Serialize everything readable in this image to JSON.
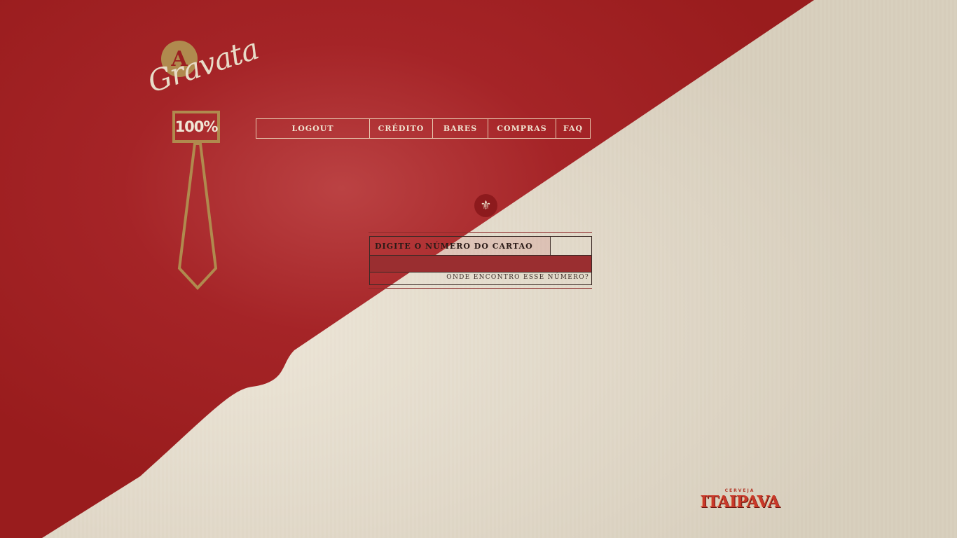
{
  "logo": {
    "letter": "A",
    "word": "Gravata",
    "badge": "100%"
  },
  "nav": {
    "items": [
      {
        "label": "LOGOUT"
      },
      {
        "label": "CRÉDITO"
      },
      {
        "label": "BARES"
      },
      {
        "label": "COMPRAS"
      },
      {
        "label": "FAQ"
      }
    ]
  },
  "emblem": {
    "icon": "fleur-de-lis-icon"
  },
  "card_form": {
    "label": "DIGITE O NÚMERO DO CARTAO",
    "value": "",
    "help_link": "ONDE ENCONTRO ESSE NÚMERO?"
  },
  "brand": {
    "small": "CERVEJA",
    "name": "ITAIPAVA"
  },
  "colors": {
    "red": "#a3201f",
    "beige": "#e6ddcd",
    "gold": "#b08a4e"
  }
}
